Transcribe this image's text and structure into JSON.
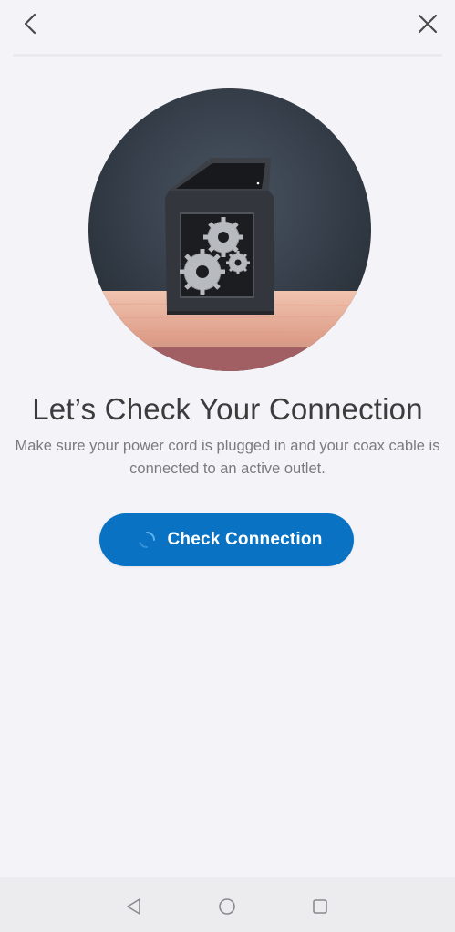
{
  "header": {
    "back_icon": "chevron-left-icon",
    "close_icon": "close-icon"
  },
  "hero": {
    "illustration": "gateway-device-with-gears"
  },
  "content": {
    "title": "Let’s Check Your Connection",
    "subtitle": "Make sure your power cord is plugged in and your coax cable is connected to an active outlet."
  },
  "action": {
    "check_label": "Check Connection",
    "state": "loading",
    "color": "#0a72c2"
  },
  "system_nav": {
    "back_icon": "triangle-back-icon",
    "home_icon": "circle-home-icon",
    "recents_icon": "square-recents-icon"
  }
}
